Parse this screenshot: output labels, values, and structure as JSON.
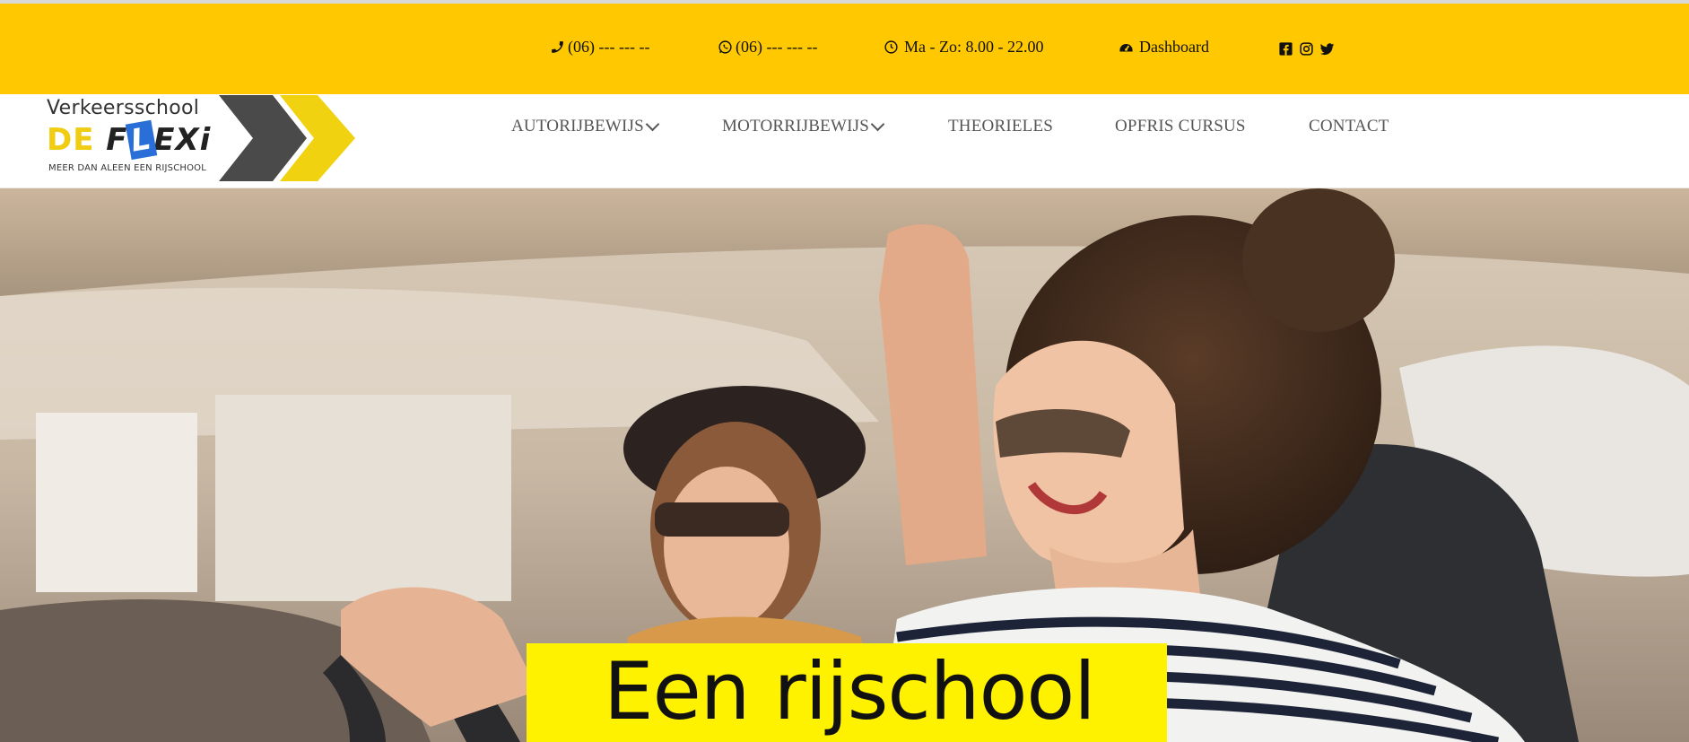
{
  "topbar": {
    "phone": {
      "icon": "phone-icon",
      "text": "(06) --- --- --"
    },
    "whatsapp": {
      "icon": "whatsapp-icon",
      "text": "(06) --- --- --"
    },
    "hours": {
      "icon": "clock-icon",
      "text": "Ma - Zo: 8.00 - 22.00"
    },
    "dashboard": {
      "icon": "dashboard-icon",
      "text": "Dashboard"
    },
    "social": [
      "facebook-icon",
      "instagram-icon",
      "twitter-icon"
    ],
    "background": "#ffc800"
  },
  "logo": {
    "line1": "Verkeersschool",
    "de": "DE",
    "f": "F",
    "l": "L",
    "exi": "EXi",
    "tagline": "MEER DAN ALEEN EEN RIJSCHOOL",
    "chevron_dark": "#4a4a4a",
    "chevron_yellow": "#f0d210"
  },
  "nav": {
    "items": [
      {
        "label": "AUTORIJBEWIJS",
        "dropdown": true
      },
      {
        "label": "MOTORRIJBEWIJS",
        "dropdown": true
      },
      {
        "label": "THEORIELES",
        "dropdown": false
      },
      {
        "label": "OPFRIS CURSUS",
        "dropdown": false
      },
      {
        "label": "CONTACT",
        "dropdown": false
      }
    ]
  },
  "hero": {
    "headline": "Een rijschool",
    "headline_bg": "#fff200"
  }
}
